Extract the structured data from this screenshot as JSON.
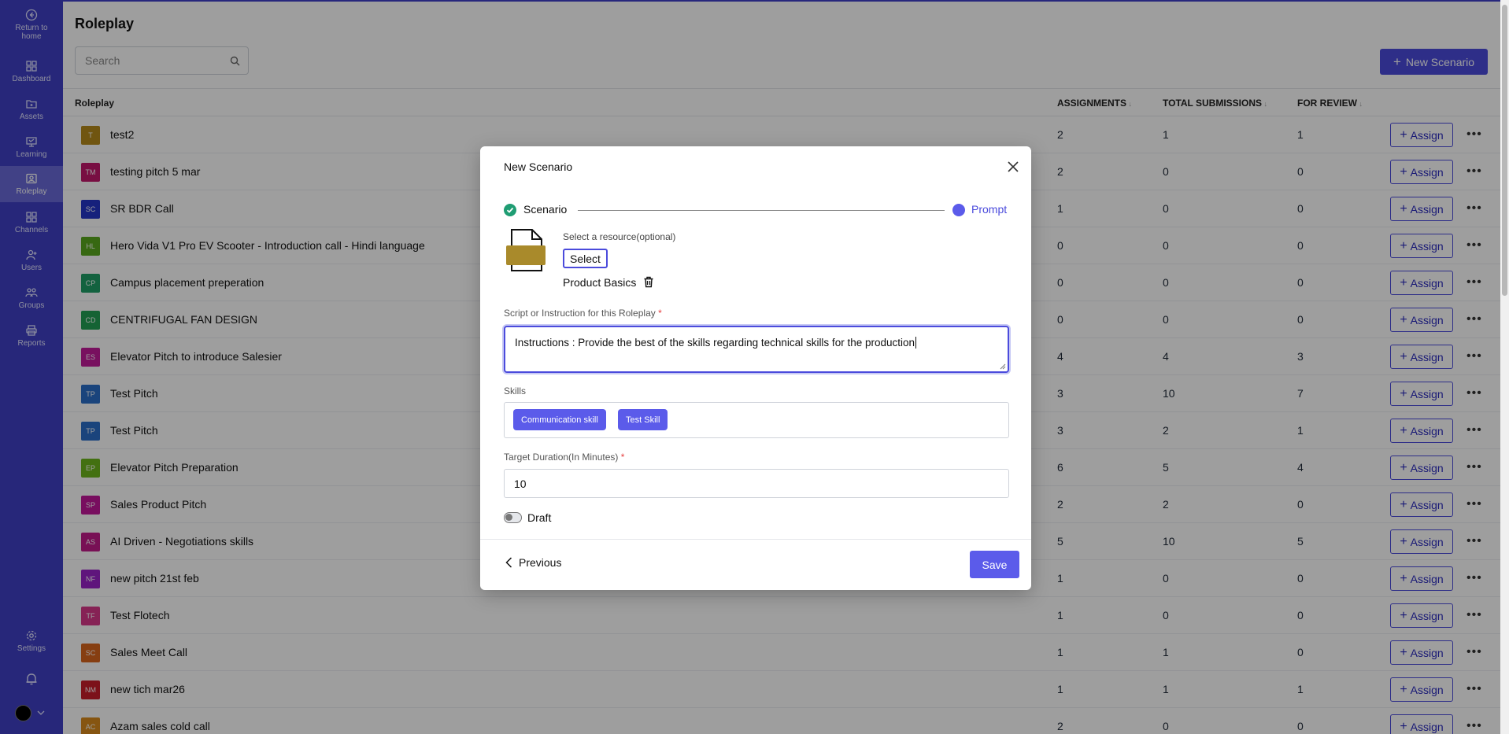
{
  "sidebar": {
    "items": [
      {
        "label": "Return to home",
        "icon": "return-home-icon"
      },
      {
        "label": "Dashboard",
        "icon": "dashboard-icon"
      },
      {
        "label": "Assets",
        "icon": "assets-folder-icon"
      },
      {
        "label": "Learning",
        "icon": "learning-icon"
      },
      {
        "label": "Roleplay",
        "icon": "roleplay-icon"
      },
      {
        "label": "Channels",
        "icon": "channels-icon"
      },
      {
        "label": "Users",
        "icon": "users-icon"
      },
      {
        "label": "Groups",
        "icon": "groups-icon"
      },
      {
        "label": "Reports",
        "icon": "reports-icon"
      },
      {
        "label": "Settings",
        "icon": "settings-gear-icon"
      }
    ]
  },
  "page": {
    "title": "Roleplay",
    "search_placeholder": "Search",
    "new_button": "New Scenario"
  },
  "table": {
    "headers": [
      "Roleplay",
      "ASSIGNMENTS",
      "TOTAL SUBMISSIONS",
      "FOR REVIEW"
    ],
    "assign_label": "Assign",
    "rows": [
      {
        "initials": "T",
        "color": "#b58a1a",
        "name": "test2",
        "assignments": "2",
        "submissions": "1",
        "review": "1"
      },
      {
        "initials": "TM",
        "color": "#c2186b",
        "name": "testing pitch 5 mar",
        "assignments": "2",
        "submissions": "0",
        "review": "0"
      },
      {
        "initials": "SC",
        "color": "#2536c8",
        "name": "SR BDR Call",
        "assignments": "1",
        "submissions": "0",
        "review": "0"
      },
      {
        "initials": "HL",
        "color": "#5aa81e",
        "name": "Hero Vida V1 Pro EV Scooter - Introduction call - Hindi language",
        "assignments": "0",
        "submissions": "0",
        "review": "0"
      },
      {
        "initials": "CP",
        "color": "#1f9f66",
        "name": "Campus placement preperation",
        "assignments": "0",
        "submissions": "0",
        "review": "0"
      },
      {
        "initials": "CD",
        "color": "#22a055",
        "name": "CENTRIFUGAL FAN DESIGN",
        "assignments": "0",
        "submissions": "0",
        "review": "0"
      },
      {
        "initials": "ES",
        "color": "#c21a9a",
        "name": "Elevator Pitch to introduce Salesier",
        "assignments": "4",
        "submissions": "4",
        "review": "3"
      },
      {
        "initials": "TP",
        "color": "#2b6fc8",
        "name": "Test Pitch",
        "assignments": "3",
        "submissions": "10",
        "review": "7"
      },
      {
        "initials": "TP",
        "color": "#2b6fc8",
        "name": "Test Pitch",
        "assignments": "3",
        "submissions": "2",
        "review": "1"
      },
      {
        "initials": "EP",
        "color": "#6cb51c",
        "name": "Elevator Pitch Preparation",
        "assignments": "6",
        "submissions": "5",
        "review": "4"
      },
      {
        "initials": "SP",
        "color": "#c2189a",
        "name": "Sales Product Pitch",
        "assignments": "2",
        "submissions": "2",
        "review": "0"
      },
      {
        "initials": "AS",
        "color": "#c21a8a",
        "name": "AI Driven - Negotiations skills",
        "assignments": "5",
        "submissions": "10",
        "review": "5"
      },
      {
        "initials": "NF",
        "color": "#9a22c8",
        "name": "new pitch 21st feb",
        "assignments": "1",
        "submissions": "0",
        "review": "0"
      },
      {
        "initials": "TF",
        "color": "#d8388a",
        "name": "Test Flotech",
        "assignments": "1",
        "submissions": "0",
        "review": "0"
      },
      {
        "initials": "SC",
        "color": "#d8641c",
        "name": "Sales Meet Call",
        "assignments": "1",
        "submissions": "1",
        "review": "0"
      },
      {
        "initials": "NM",
        "color": "#c81e2a",
        "name": "new tich mar26",
        "assignments": "1",
        "submissions": "1",
        "review": "1"
      },
      {
        "initials": "AC",
        "color": "#d88a1c",
        "name": "Azam sales cold call",
        "assignments": "2",
        "submissions": "0",
        "review": "0"
      }
    ]
  },
  "modal": {
    "title": "New Scenario",
    "step1": "Scenario",
    "step2": "Prompt",
    "resource_label": "Select a resource(optional)",
    "select_button": "Select",
    "resource_name": "Product Basics",
    "script_label": "Script or Instruction for this Roleplay",
    "script_value": "Instructions : Provide the best of the skills regarding technical skills for the production",
    "skills_label": "Skills",
    "skills": [
      "Communication skill",
      "Test Skill"
    ],
    "duration_label": "Target Duration(In Minutes)",
    "duration_value": "10",
    "draft_label": "Draft",
    "previous_button": "Previous",
    "save_button": "Save",
    "required_mark": "*"
  },
  "colors": {
    "sidebar": "#3f3fc6",
    "accent": "#4b4bdc",
    "step_done": "#1f9d73"
  }
}
